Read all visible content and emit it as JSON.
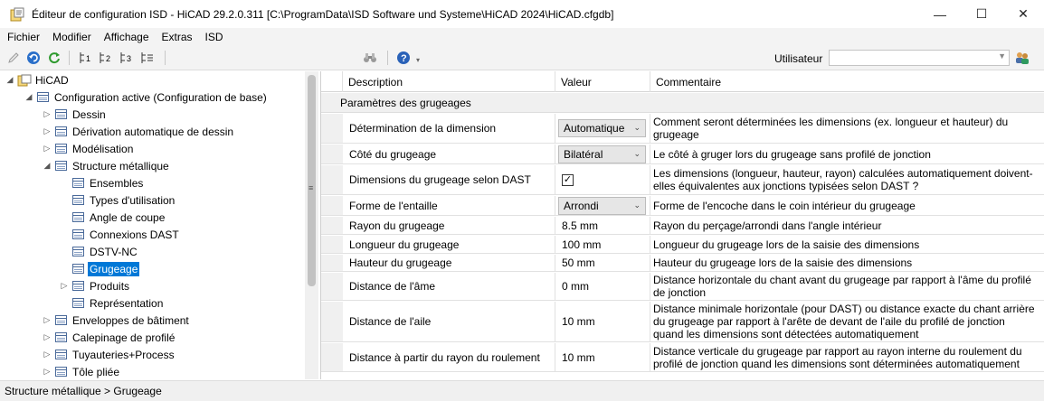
{
  "window": {
    "title": "Éditeur de configuration ISD  -  HiCAD 29.2.0.311 [C:\\ProgramData\\ISD Software und Systeme\\HiCAD 2024\\HiCAD.cfgdb]",
    "minimize_icon": "minimize-icon",
    "maximize_icon": "maximize-icon",
    "close_icon": "close-icon"
  },
  "menu": [
    "Fichier",
    "Modifier",
    "Affichage",
    "Extras",
    "ISD"
  ],
  "toolbar": {
    "user_label": "Utilisateur",
    "user_value": "",
    "icons": [
      "pencil-icon",
      "undo-icon",
      "refresh-icon",
      "level-1-icon",
      "level-2-icon",
      "level-3-icon",
      "level-all-icon",
      "binoculars-icon",
      "help-icon",
      "users-icon"
    ]
  },
  "tree": [
    {
      "label": "HiCAD",
      "depth": 0,
      "expander": "expanded"
    },
    {
      "label": "Configuration active (Configuration de base)",
      "depth": 1,
      "expander": "expanded"
    },
    {
      "label": "Dessin",
      "depth": 2,
      "expander": "collapsed"
    },
    {
      "label": "Dérivation automatique de dessin",
      "depth": 2,
      "expander": "collapsed"
    },
    {
      "label": "Modélisation",
      "depth": 2,
      "expander": "collapsed"
    },
    {
      "label": "Structure métallique",
      "depth": 2,
      "expander": "expanded"
    },
    {
      "label": "Ensembles",
      "depth": 3,
      "expander": "none"
    },
    {
      "label": "Types d'utilisation",
      "depth": 3,
      "expander": "none"
    },
    {
      "label": "Angle de coupe",
      "depth": 3,
      "expander": "none"
    },
    {
      "label": "Connexions DAST",
      "depth": 3,
      "expander": "none"
    },
    {
      "label": "DSTV-NC",
      "depth": 3,
      "expander": "none"
    },
    {
      "label": "Grugeage",
      "depth": 3,
      "expander": "none",
      "selected": true
    },
    {
      "label": "Produits",
      "depth": 3,
      "expander": "collapsed"
    },
    {
      "label": "Représentation",
      "depth": 3,
      "expander": "none"
    },
    {
      "label": "Enveloppes de bâtiment",
      "depth": 2,
      "expander": "collapsed"
    },
    {
      "label": "Calepinage de profilé",
      "depth": 2,
      "expander": "collapsed"
    },
    {
      "label": "Tuyauteries+Process",
      "depth": 2,
      "expander": "collapsed"
    },
    {
      "label": "Tôle pliée",
      "depth": 2,
      "expander": "collapsed"
    }
  ],
  "grid": {
    "headers": {
      "description": "Description",
      "value": "Valeur",
      "comment": "Commentaire"
    },
    "group": "Paramètres des grugeages",
    "rows": [
      {
        "description": "Détermination de la dimension",
        "type": "combo",
        "value": "Automatique",
        "comment": "Comment seront déterminées les dimensions (ex. longueur et hauteur) du grugeage"
      },
      {
        "description": "Côté du grugeage",
        "type": "combo",
        "value": "Bilatéral",
        "comment": "Le côté à gruger lors du grugeage sans profilé de jonction"
      },
      {
        "description": "Dimensions du grugeage selon DAST",
        "type": "checkbox",
        "value": "✓",
        "comment": "Les dimensions (longueur, hauteur, rayon) calculées automatiquement doivent-elles équivalentes aux jonctions typisées selon DAST ?"
      },
      {
        "description": "Forme de l'entaille",
        "type": "combo",
        "value": "Arrondi",
        "comment": "Forme de l'encoche dans le coin intérieur du grugeage"
      },
      {
        "description": "Rayon du grugeage",
        "type": "text",
        "value": "8.5 mm",
        "comment": "Rayon du perçage/arrondi dans l'angle intérieur"
      },
      {
        "description": "Longueur du grugeage",
        "type": "text",
        "value": "100 mm",
        "comment": "Longueur du grugeage lors de la saisie des dimensions"
      },
      {
        "description": "Hauteur du grugeage",
        "type": "text",
        "value": "50 mm",
        "comment": "Hauteur du grugeage lors de la saisie des dimensions"
      },
      {
        "description": "Distance de l'âme",
        "type": "text",
        "value": "0 mm",
        "comment": "Distance horizontale du chant avant du grugeage par rapport à l'âme du profilé de jonction"
      },
      {
        "description": "Distance de l'aile",
        "type": "text",
        "value": "10 mm",
        "comment": "Distance minimale horizontale (pour DAST) ou distance exacte du chant arrière du grugeage par rapport à l'arête de devant de l'aile du profilé de jonction quand les dimensions sont détectées automatiquement"
      },
      {
        "description": "Distance à partir du rayon du roulement",
        "type": "text",
        "value": "10 mm",
        "comment": "Distance verticale du grugeage par rapport au rayon interne du roulement du profilé de jonction quand les dimensions sont déterminées automatiquement"
      }
    ]
  },
  "status": "Structure métallique > Grugeage",
  "colors": {
    "selection": "#0078d7",
    "chrome": "#f3f3f3"
  }
}
